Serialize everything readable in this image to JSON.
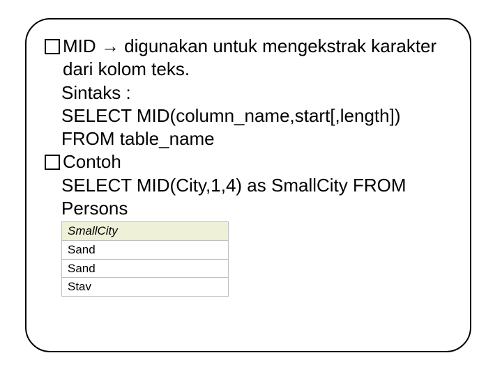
{
  "slide": {
    "bullet1": {
      "lead": "MID",
      "arrow": "→",
      "rest": " digunakan untuk mengekstrak karakter dari kolom teks."
    },
    "syntax_label": "Sintaks :",
    "syntax_line1": "SELECT MID(column_name,start[,length]) FROM table_name",
    "bullet2": "Contoh",
    "example": "SELECT MID(City,1,4) as SmallCity FROM Persons",
    "table": {
      "header": "SmallCity",
      "rows": [
        "Sand",
        "Sand",
        "Stav"
      ]
    }
  }
}
